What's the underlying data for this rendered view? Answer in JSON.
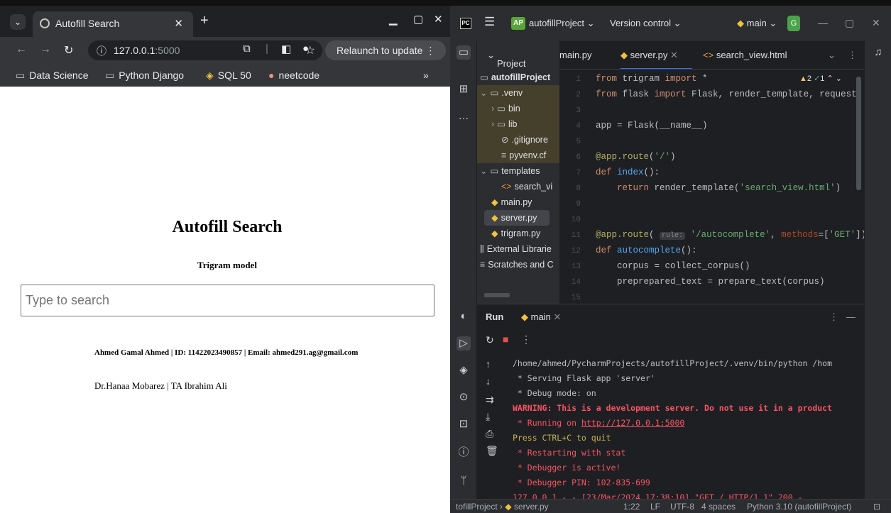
{
  "browser": {
    "tab_title": "Autofill Search",
    "url_host": "127.0.0.1",
    "url_port": ":5000",
    "relaunch_label": "Relaunch to update",
    "bookmarks": [
      "Data Science",
      "Python Django",
      "SQL 50",
      "neetcode"
    ],
    "more_bookmarks": "»"
  },
  "page": {
    "title": "Autofill Search",
    "subtitle": "Trigram model",
    "search_placeholder": "Type to search",
    "author": "Ahmed Gamal Ahmed | ID: 11422023490857 | Email: ahmed291.ag@gmail.com",
    "supervisors": "Dr.Hanaa Mobarez | TA Ibrahim Ali"
  },
  "ide": {
    "project_badge": "AP",
    "project_name": "autofillProject",
    "vcs_label": "Version control",
    "branch": "main",
    "project_panel_label": "Project",
    "tabs": [
      "main.py",
      "server.py",
      "search_view.html"
    ],
    "tree": {
      "root": "autofillProject",
      "venv": ".venv",
      "bin": "bin",
      "lib": "lib",
      "gitignore": ".gitignore",
      "pyvenv": "pyvenv.cf",
      "templates": "templates",
      "search_view": "search_vi",
      "main": "main.py",
      "server": "server.py",
      "trigram": "trigram.py",
      "ext_libs": "External Librarie",
      "scratches": "Scratches and C"
    },
    "inspection": {
      "warnings": "2",
      "weak": "1"
    },
    "line_numbers": [
      "1",
      "2",
      "3",
      "4",
      "5",
      "6",
      "7",
      "8",
      "9",
      "10",
      "11",
      "12",
      "13",
      "14",
      "15"
    ],
    "run_label": "Run",
    "run_config": "main",
    "console": [
      "/home/ahmed/PycharmProjects/autofillProject/.venv/bin/python /hom",
      " * Serving Flask app 'server'",
      " * Debug mode: on",
      "WARNING: This is a development server. Do not use it in a product",
      " * Running on ",
      "http://127.0.0.1:5000",
      "Press CTRL+C to quit",
      " * Restarting with stat",
      " * Debugger is active!",
      " * Debugger PIN: 102-835-699",
      "127.0.0.1 - - [23/Mar/2024 17:38:10] \"GET / HTTP/1.1\" 200 -"
    ],
    "status": {
      "breadcrumb_project": "tofillProject",
      "breadcrumb_file": "server.py",
      "position": "1:22",
      "line_sep": "LF",
      "encoding": "UTF-8",
      "indent": "4 spaces",
      "interpreter": "Python 3.10 (autofillProject)"
    }
  }
}
